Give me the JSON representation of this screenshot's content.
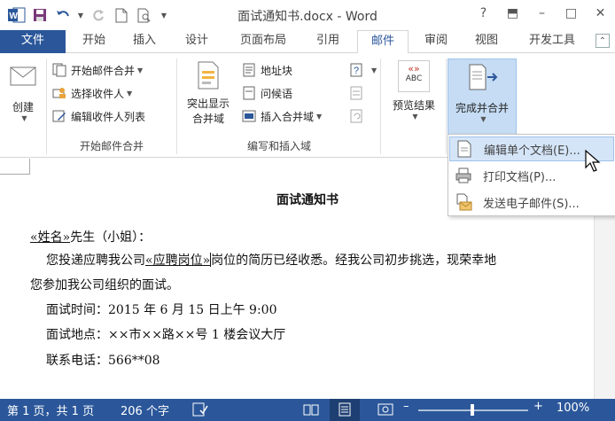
{
  "window": {
    "title": "面试通知书.docx - Word",
    "help_label": "?",
    "ribbon_display_label": "⬒",
    "minimize_label": "–",
    "restore_label": "□",
    "close_label": "✕"
  },
  "tabs": [
    {
      "label": "文件"
    },
    {
      "label": "开始"
    },
    {
      "label": "插入"
    },
    {
      "label": "设计"
    },
    {
      "label": "页面布局"
    },
    {
      "label": "引用"
    },
    {
      "label": "邮件"
    },
    {
      "label": "审阅"
    },
    {
      "label": "视图"
    },
    {
      "label": "开发工具"
    }
  ],
  "ribbon": {
    "create_label": "创建",
    "start_merge_group": {
      "label": "开始邮件合并",
      "start_merge": "开始邮件合并",
      "select_recipients": "选择收件人",
      "edit_recipients": "编辑收件人列表"
    },
    "write_insert_group": {
      "label": "编写和插入域",
      "highlight_line1": "突出显示",
      "highlight_line2": "合并域",
      "address_block": "地址块",
      "greeting_line": "问候语",
      "insert_field": "插入合并域"
    },
    "preview": {
      "label": "预览结果",
      "abc_label": "ABC",
      "sample_label": "«»"
    },
    "finish": {
      "label": "完成并合并"
    }
  },
  "finish_menu": {
    "items": [
      {
        "label": "编辑单个文档(E)..."
      },
      {
        "label": "打印文档(P)..."
      },
      {
        "label": "发送电子邮件(S)..."
      }
    ]
  },
  "document": {
    "title": "面试通知书",
    "line1_field": "«姓名»",
    "line1_rest": "先生（小姐）：",
    "line2_pre": "您投递应聘我公司",
    "line2_field": "«应聘岗位»",
    "line2_post": "岗位的简历已经收悉。经我公司初步挑选，现荣幸地",
    "line3": "您参加我公司组织的面试。",
    "line4": "面试时间：2015 年 6 月 15 日上午 9:00",
    "line5": "面试地点：××市××路××号 1 楼会议大厅",
    "line6": "联系电话：566**08"
  },
  "statusbar": {
    "page": "第 1 页，共 1 页",
    "words": "206 个字",
    "zoom": "100%",
    "zoom_minus": "–",
    "zoom_plus": "+"
  },
  "colors": {
    "accent": "#2b579a",
    "highlight": "#c5dcf4",
    "menu_hover": "#d5e5f8"
  }
}
